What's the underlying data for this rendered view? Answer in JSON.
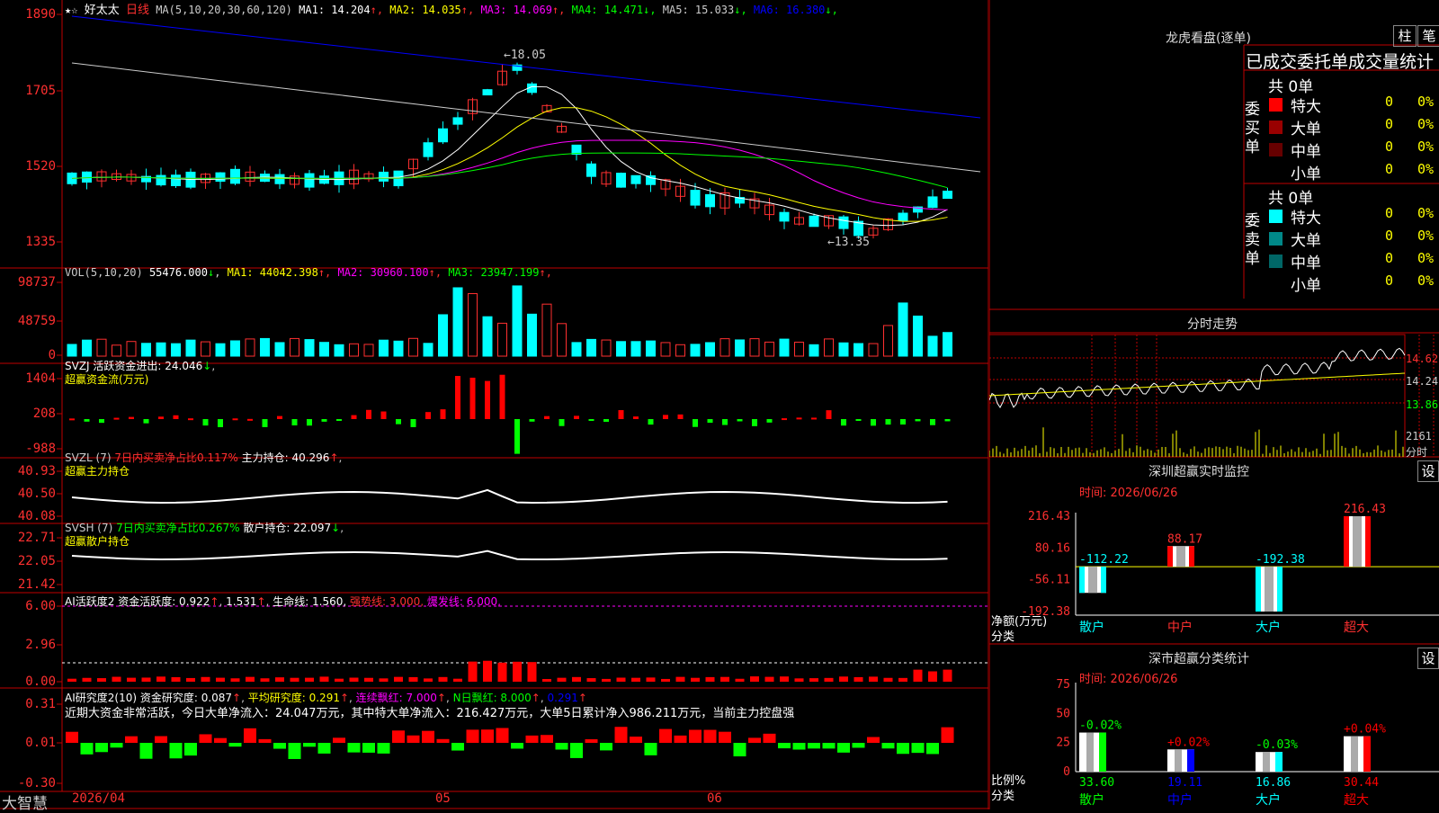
{
  "main_chart": {
    "star": "★☆",
    "stock_name": "好太太",
    "period": "日线",
    "ma_def": "MA(5,10,20,30,60,120)",
    "ma": [
      {
        "label": "MA1: 14.204",
        "arrow": "↑",
        "color": "#ffffff"
      },
      {
        "label": "MA2: 14.035",
        "arrow": "↑",
        "color": "#ffff00"
      },
      {
        "label": "MA3: 14.069",
        "arrow": "↑",
        "color": "#ff00ff"
      },
      {
        "label": "MA4: 14.471",
        "arrow": "↓",
        "color": "#00ff00"
      },
      {
        "label": "MA5: 15.033",
        "arrow": "↓",
        "color": "#cccccc"
      },
      {
        "label": "MA6: 16.380",
        "arrow": "↓",
        "color": "#0000ff"
      }
    ],
    "yticks": [
      "1890",
      "1705",
      "1520",
      "1335"
    ],
    "high_label": "18.05",
    "low_label": "13.35"
  },
  "vol_panel": {
    "title": "VOL(5,10,20)",
    "value": "55476.000",
    "value_arrow": "↓",
    "ma": [
      {
        "label": "MA1: 44042.398",
        "arrow": "↑",
        "color": "#ffff00"
      },
      {
        "label": "MA2: 30960.100",
        "arrow": "↑",
        "color": "#ff00ff"
      },
      {
        "label": "MA3: 23947.199",
        "arrow": "↑",
        "color": "#00ff00"
      }
    ],
    "yticks": [
      "98737",
      "48759",
      "0"
    ]
  },
  "svzj_panel": {
    "title": "SVZJ  活跃资金进出: 24.046",
    "arrow": "↓",
    "subtitle": "超赢资金流(万元)",
    "yticks": [
      "1404",
      "208",
      "-988"
    ]
  },
  "svzl_panel": {
    "title": "SVZL (7) ",
    "title2": "7日内买卖净占比0.117%",
    "title3": " 主力持仓: 40.296",
    "arrow": "↑",
    "subtitle": "超赢主力持仓",
    "yticks": [
      "40.93",
      "40.50",
      "40.08"
    ]
  },
  "svsh_panel": {
    "title": "SVSH (7) ",
    "title2": "7日内买卖净占比0.267%",
    "title3": " 散户持仓: 22.097",
    "arrow": "↓",
    "subtitle": "超赢散户持仓",
    "yticks": [
      "22.71",
      "22.05",
      "21.42"
    ]
  },
  "ai_active": {
    "title": "AI活跃度2 资金活跃度: 0.922",
    "v2": "1.531",
    "v3": "生命线: 1.560,",
    "v4": "强势线: 3.000,",
    "v5": "爆发线: 6.000,",
    "yticks": [
      "6.00",
      "2.96",
      "0.00"
    ]
  },
  "ai_research": {
    "title": "AI研究度2(10) 资金研究度: 0.087",
    "v2": "平均研究度: 0.291",
    "v3": "连续飘红: 7.000",
    "v4": "N日飘红: 8.000",
    "v5": "0.291",
    "comment": "近期大资金非常活跃，今日大单净流入：24.047万元，其中特大单净流入：216.427万元，大单5日累计净入986.211万元，当前主力控盘强",
    "yticks": [
      "0.31",
      "0.01",
      "-0.30"
    ]
  },
  "xaxis": {
    "brand": "大智慧",
    "labels": [
      "2026/04",
      "05",
      "06"
    ]
  },
  "lhb": {
    "title": "龙虎看盘(逐单)",
    "btn1": "柱",
    "btn2": "笔",
    "header": "已成交委托单成交量统计",
    "buy_label": "委买单",
    "sell_label": "委卖单",
    "buy_total": "共 0单",
    "sell_total": "共 0单",
    "buy_rows": [
      {
        "name": "特大",
        "vol": "0",
        "pct": "0%",
        "color": "#ff0000"
      },
      {
        "name": "大单",
        "vol": "0",
        "pct": "0%",
        "color": "#990000"
      },
      {
        "name": "中单",
        "vol": "0",
        "pct": "0%",
        "color": "#660000"
      },
      {
        "name": "小单",
        "vol": "0",
        "pct": "0%",
        "color": "#000000"
      }
    ],
    "sell_rows": [
      {
        "name": "特大",
        "vol": "0",
        "pct": "0%",
        "color": "#00ffff"
      },
      {
        "name": "大单",
        "vol": "0",
        "pct": "0%",
        "color": "#008888"
      },
      {
        "name": "中单",
        "vol": "0",
        "pct": "0%",
        "color": "#006666"
      },
      {
        "name": "小单",
        "vol": "0",
        "pct": "0%",
        "color": "#000000"
      }
    ]
  },
  "intraday": {
    "title": "分时走势",
    "yticks": [
      "14.62",
      "14.24",
      "13.86"
    ],
    "vol_label": "2161",
    "unit_label": "分时"
  },
  "monitor": {
    "title": "深圳超赢实时监控",
    "set_btn": "设",
    "time": "时间: 2026/06/26",
    "yticks": [
      "216.43",
      "80.16",
      "-56.11",
      "-192.38"
    ],
    "ylabel": "净额(万元)",
    "xlabel": "分类",
    "bars": [
      {
        "name": "散户",
        "value": -112.22,
        "label": "-112.22",
        "color": "#00ffff"
      },
      {
        "name": "中户",
        "value": 88.17,
        "label": "88.17",
        "color": "#ff0000"
      },
      {
        "name": "大户",
        "value": -192.38,
        "label": "-192.38",
        "color": "#00ffff"
      },
      {
        "name": "超大",
        "value": 216.43,
        "label": "216.43",
        "color": "#ff0000"
      }
    ]
  },
  "classify": {
    "title": "深市超赢分类统计",
    "set_btn": "设",
    "time": "时间: 2026/06/26",
    "yticks": [
      "75",
      "50",
      "25",
      "0"
    ],
    "ylabel": "比例%",
    "xlabel": "分类",
    "bars": [
      {
        "name": "散户",
        "value": 33.6,
        "label": "33.60",
        "change": "-0.02%",
        "color": "#00ff00",
        "change_color": "#00ff00"
      },
      {
        "name": "中户",
        "value": 19.11,
        "label": "19.11",
        "change": "+0.02%",
        "color": "#0000ff",
        "change_color": "#ff0000"
      },
      {
        "name": "大户",
        "value": 16.86,
        "label": "16.86",
        "change": "-0.03%",
        "color": "#00ffff",
        "change_color": "#00ff00"
      },
      {
        "name": "超大",
        "value": 30.44,
        "label": "30.44",
        "change": "+0.04%",
        "color": "#ff0000",
        "change_color": "#ff0000"
      }
    ]
  },
  "chart_data": {
    "type": "bar",
    "categories": [
      "散户",
      "中户",
      "大户",
      "超大"
    ],
    "series": [
      {
        "name": "净额(万元)",
        "values": [
          -112.22,
          88.17,
          -192.38,
          216.43
        ]
      },
      {
        "name": "比例%",
        "values": [
          33.6,
          19.11,
          16.86,
          30.44
        ]
      }
    ]
  }
}
